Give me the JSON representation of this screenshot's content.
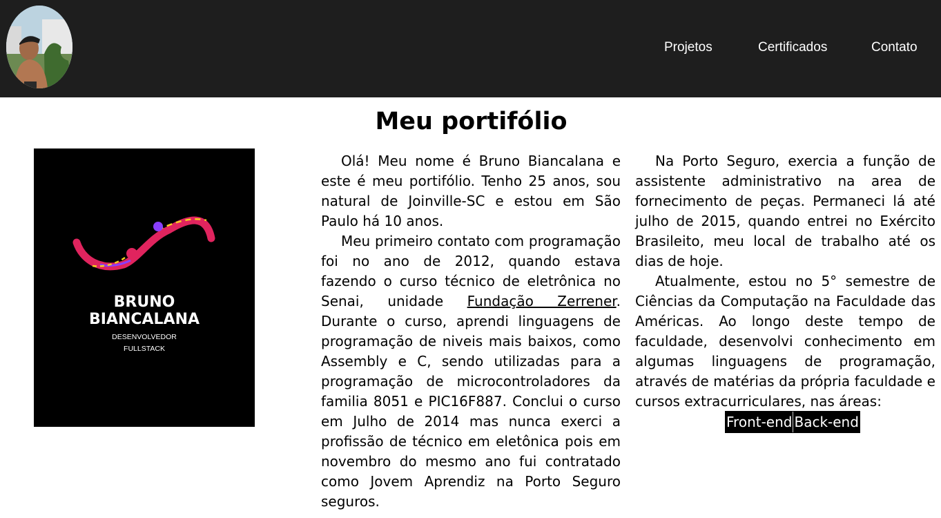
{
  "nav": {
    "projects": "Projetos",
    "certificates": "Certificados",
    "contact": "Contato"
  },
  "page_title": "Meu portifólio",
  "card": {
    "name_line1": "BRUNO",
    "name_line2": "BIANCALANA",
    "role_line1": "DESENVOLVEDOR",
    "role_line2": "FULLSTACK"
  },
  "intro": {
    "p1": "Olá! Meu nome é Bruno Biancalana e este é meu portifólio. Tenho 25 anos, sou natural de Joinville-SC e estou em São Paulo há 10 anos.",
    "p2_before_link": "Meu primeiro contato com programação foi no ano de 2012, quando estava fazendo o curso técnico de eletrônica no Senai, unidade ",
    "p2_link": "Fundação Zerrener",
    "p2_after_link": ". Durante o curso, aprendi linguagens de programação de niveis mais baixos, como Assembly e C, sendo utilizadas para a programação de microcontroladores da familia 8051 e PIC16F887. Conclui o curso em Julho de 2014 mas nunca exerci a profissão de técnico em eletônica pois em novembro do mesmo ano fui contratado como Jovem Aprendiz na Porto Seguro seguros."
  },
  "career": {
    "p1": "Na Porto Seguro, exercia a função de assistente administrativo na area de fornecimento de peças. Permaneci lá até julho de 2015, quando entrei no Exército Brasileito, meu local de trabalho até os dias de hoje.",
    "p2": "Atualmente, estou no 5° semestre de Ciências da Computação na Faculdade das Américas. Ao longo deste tempo de faculdade, desenvolvi conhecimento em algumas linguagens de programação, através de matérias da própria faculdade e cursos extracurriculares, nas áreas:"
  },
  "areas": [
    "Front-end",
    "Back-end"
  ],
  "colors": {
    "header_bg": "#1e1e1e",
    "card_bg": "#000000",
    "accent_pink": "#e0245e",
    "accent_yellow": "#f5d020",
    "accent_purple": "#8a3ffc"
  }
}
